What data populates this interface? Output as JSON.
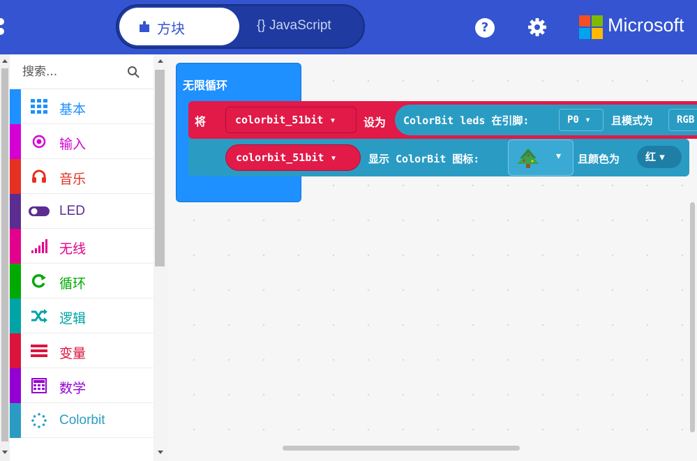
{
  "header": {
    "tabs": [
      {
        "label": "方块",
        "active": true
      },
      {
        "label": "{} JavaScript",
        "active": false
      }
    ],
    "help_glyph": "?",
    "brand": "Microsoft",
    "icons": [
      "menu-icon",
      "puzzle-icon",
      "help-icon",
      "gear-icon",
      "microsoft-logo"
    ]
  },
  "toolbox": {
    "search_placeholder": "搜索...",
    "categories": [
      {
        "label": "基本",
        "icon": "grid-icon",
        "color": "#1e90ff"
      },
      {
        "label": "输入",
        "icon": "radio-icon",
        "color": "#d400d4"
      },
      {
        "label": "音乐",
        "icon": "headphones-icon",
        "color": "#e63022"
      },
      {
        "label": "LED",
        "icon": "toggle-icon",
        "color": "#5c2d91"
      },
      {
        "label": "无线",
        "icon": "signal-icon",
        "color": "#e3008c"
      },
      {
        "label": "循环",
        "icon": "loop-icon",
        "color": "#00aa00"
      },
      {
        "label": "逻辑",
        "icon": "shuffle-icon",
        "color": "#00a4a6"
      },
      {
        "label": "变量",
        "icon": "lines-icon",
        "color": "#dc143c"
      },
      {
        "label": "数学",
        "icon": "calculator-icon",
        "color": "#9400d3"
      },
      {
        "label": "Colorbit",
        "icon": "dots-circle-icon",
        "color": "#2a9cc4"
      }
    ]
  },
  "blocks": {
    "loop_label": "无限循环",
    "set_label": "将",
    "variable": "colorbit_51bit ▾",
    "set_to": "设为",
    "init_text": "ColorBit leds 在引脚:",
    "pin": "P0 ▾",
    "mode_text": "且模式为",
    "mode": "RGB",
    "show_var": "colorbit_51bit ▾",
    "show_text": "显示 ColorBit 图标:",
    "icon_dropdown": "▾",
    "color_text": "且颜色为",
    "color": "红 ▾"
  }
}
